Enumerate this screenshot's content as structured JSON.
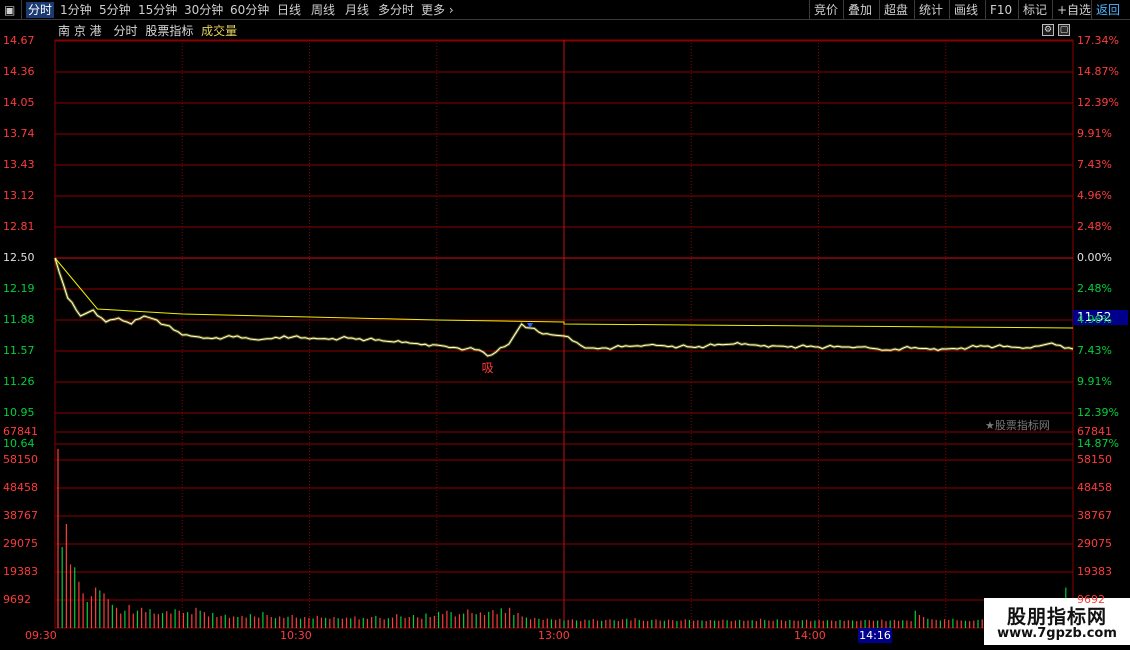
{
  "toolbar": {
    "left": [
      "分时",
      "1分钟",
      "5分钟",
      "15分钟",
      "30分钟",
      "60分钟",
      "日线",
      "周线",
      "月线",
      "多分时",
      "更多"
    ],
    "right": [
      "竞价",
      "叠加",
      "超盘",
      "统计",
      "画线",
      "F10",
      "标记",
      "+自选",
      "返回"
    ],
    "active_index": 0
  },
  "stock": {
    "name": "南 京 港",
    "view": "分时",
    "indicator": "股票指标",
    "volume_label": "成交量"
  },
  "price_axis": {
    "left": [
      "14.67",
      "14.36",
      "14.05",
      "13.74",
      "13.43",
      "13.12",
      "12.81",
      "12.50",
      "12.19",
      "11.88",
      "11.57",
      "11.26",
      "10.95",
      "10.64"
    ],
    "right": [
      "17.34%",
      "14.87%",
      "12.39%",
      "9.91%",
      "7.43%",
      "4.96%",
      "2.48%",
      "0.00%",
      "2.48%",
      "4.96%",
      "7.43%",
      "9.91%",
      "12.39%",
      "14.87%"
    ]
  },
  "volume_axis": {
    "labels": [
      "67841",
      "58150",
      "48458",
      "38767",
      "29075",
      "19383",
      "9692"
    ]
  },
  "time_axis": {
    "labels": [
      "09:30",
      "10:30",
      "13:00",
      "14:00"
    ]
  },
  "current_price": "11.52",
  "cursor_time": "14:16",
  "signal_label": "吸",
  "watermark": "★股票指标网",
  "logo": {
    "line1": "股朋指标网",
    "line2": "www.7gpzb.com"
  },
  "colors": {
    "up": "#ff3c3c",
    "down": "#00d03c",
    "price_line": "#ffffff",
    "avg_line": "#f0f000",
    "grid": "#8a0000"
  },
  "chart_data": [
    {
      "type": "line",
      "title": "",
      "xlabel": "",
      "ylabel": "",
      "x_ticks": [
        "09:30",
        "10:30",
        "13:00",
        "14:00"
      ],
      "ylim": [
        10.64,
        14.67
      ],
      "pre_close": 12.5,
      "series": [
        {
          "x": [
            "09:30",
            "09:33",
            "09:36",
            "09:39",
            "09:42",
            "09:45",
            "09:48",
            "09:51",
            "09:54",
            "10:00",
            "10:06",
            "10:12",
            "10:18",
            "10:24",
            "10:30",
            "10:40",
            "10:50",
            "11:00",
            "11:05",
            "11:10",
            "11:12",
            "11:14",
            "11:17",
            "11:20",
            "11:25",
            "11:30",
            "13:00",
            "13:05",
            "13:10",
            "13:20",
            "13:30",
            "13:40",
            "13:50",
            "14:00",
            "14:10",
            "14:16",
            "14:20",
            "14:30",
            "14:40",
            "14:50",
            "14:55",
            "15:00"
          ],
          "values": [
            12.5,
            12.1,
            11.92,
            11.98,
            11.86,
            11.9,
            11.84,
            11.92,
            11.88,
            11.73,
            11.7,
            11.71,
            11.68,
            11.72,
            11.69,
            11.7,
            11.66,
            11.63,
            11.6,
            11.58,
            11.52,
            11.56,
            11.64,
            11.84,
            11.74,
            11.72,
            11.72,
            11.6,
            11.6,
            11.63,
            11.61,
            11.64,
            11.62,
            11.61,
            11.61,
            11.58,
            11.6,
            11.59,
            11.62,
            11.6,
            11.65,
            11.59
          ]
        },
        {
          "x": [
            "09:30",
            "09:40",
            "10:00",
            "10:30",
            "11:00",
            "11:30",
            "13:00",
            "13:30",
            "14:00",
            "14:30",
            "15:00"
          ],
          "values": [
            12.5,
            11.99,
            11.94,
            11.91,
            11.88,
            11.86,
            11.84,
            11.83,
            11.82,
            11.81,
            11.8
          ]
        }
      ]
    },
    {
      "type": "bar",
      "title": "",
      "xlabel": "",
      "ylabel": "",
      "ylim": [
        0,
        67841
      ],
      "x_ticks": [
        "09:30",
        "10:30",
        "13:00",
        "14:00"
      ],
      "values": [
        62000,
        28000,
        36000,
        22000,
        21000,
        16000,
        12000,
        9000,
        11000,
        14000,
        13000,
        12000,
        10000,
        8000,
        7000,
        5000,
        6000,
        8000,
        5000,
        6000,
        7000,
        5500,
        6500,
        5000,
        4800,
        5200,
        5800,
        5000,
        6500,
        6000,
        5200,
        5500,
        4800,
        7000,
        6000,
        5500,
        4000,
        5200,
        3800,
        4200,
        4600,
        3500,
        4000,
        3800,
        4200,
        3600,
        4800,
        4000,
        3600,
        5500,
        4500,
        3800,
        3400,
        4000,
        3500,
        3900,
        4500,
        3600,
        3200,
        3800,
        3500,
        3300,
        4200,
        3600,
        3500,
        3200,
        3800,
        3400,
        3200,
        3600,
        3300,
        4000,
        3000,
        3500,
        3200,
        3800,
        4200,
        3500,
        3000,
        3400,
        3600,
        4800,
        4000,
        3500,
        3800,
        4500,
        3700,
        3200,
        5000,
        3800,
        4200,
        5600,
        4800,
        6000,
        5500,
        4000,
        4800,
        5000,
        6400,
        5200,
        4800,
        5400,
        4500,
        5600,
        6200,
        4800,
        6800,
        5200,
        7000,
        4500,
        5200,
        4000,
        3600,
        3000,
        3500,
        3200,
        2800,
        3300,
        3000,
        2800,
        3200,
        2600,
        2800,
        3000,
        2600,
        2400,
        2900,
        2700,
        3100,
        2600,
        2500,
        2800,
        3000,
        2700,
        2400,
        3000,
        3200,
        2600,
        3400,
        2800,
        2500,
        2400,
        2800,
        3000,
        2600,
        2500,
        2900,
        2700,
        2400,
        2600,
        3000,
        2800,
        2500,
        2700,
        2600,
        2400,
        2800,
        2600,
        2500,
        2900,
        2700,
        2400,
        2600,
        2800,
        2500,
        2600,
        2700,
        2400,
        3200,
        2800,
        2600,
        2500,
        3000,
        2700,
        2400,
        2800,
        2600,
        2500,
        2700,
        2900,
        2400,
        2600,
        2800,
        2500,
        2700,
        2600,
        2400,
        2800,
        2500,
        2700,
        2600,
        2400,
        2600,
        2800,
        2700,
        2500,
        2600,
        2900,
        2400,
        2600,
        2800,
        2500,
        2700,
        2600,
        2400,
        6000,
        4500,
        3800,
        3200,
        3000,
        2800,
        2600,
        3000,
        2800,
        3200,
        2700,
        2600,
        2500,
        2400,
        2600,
        2800,
        3000,
        2700,
        2500,
        2600,
        3200,
        2800,
        2600,
        2400,
        2700,
        2900,
        3100,
        3400,
        3000,
        2800,
        3600,
        4000,
        3400,
        3000,
        6200,
        9000,
        14000
      ]
    }
  ]
}
